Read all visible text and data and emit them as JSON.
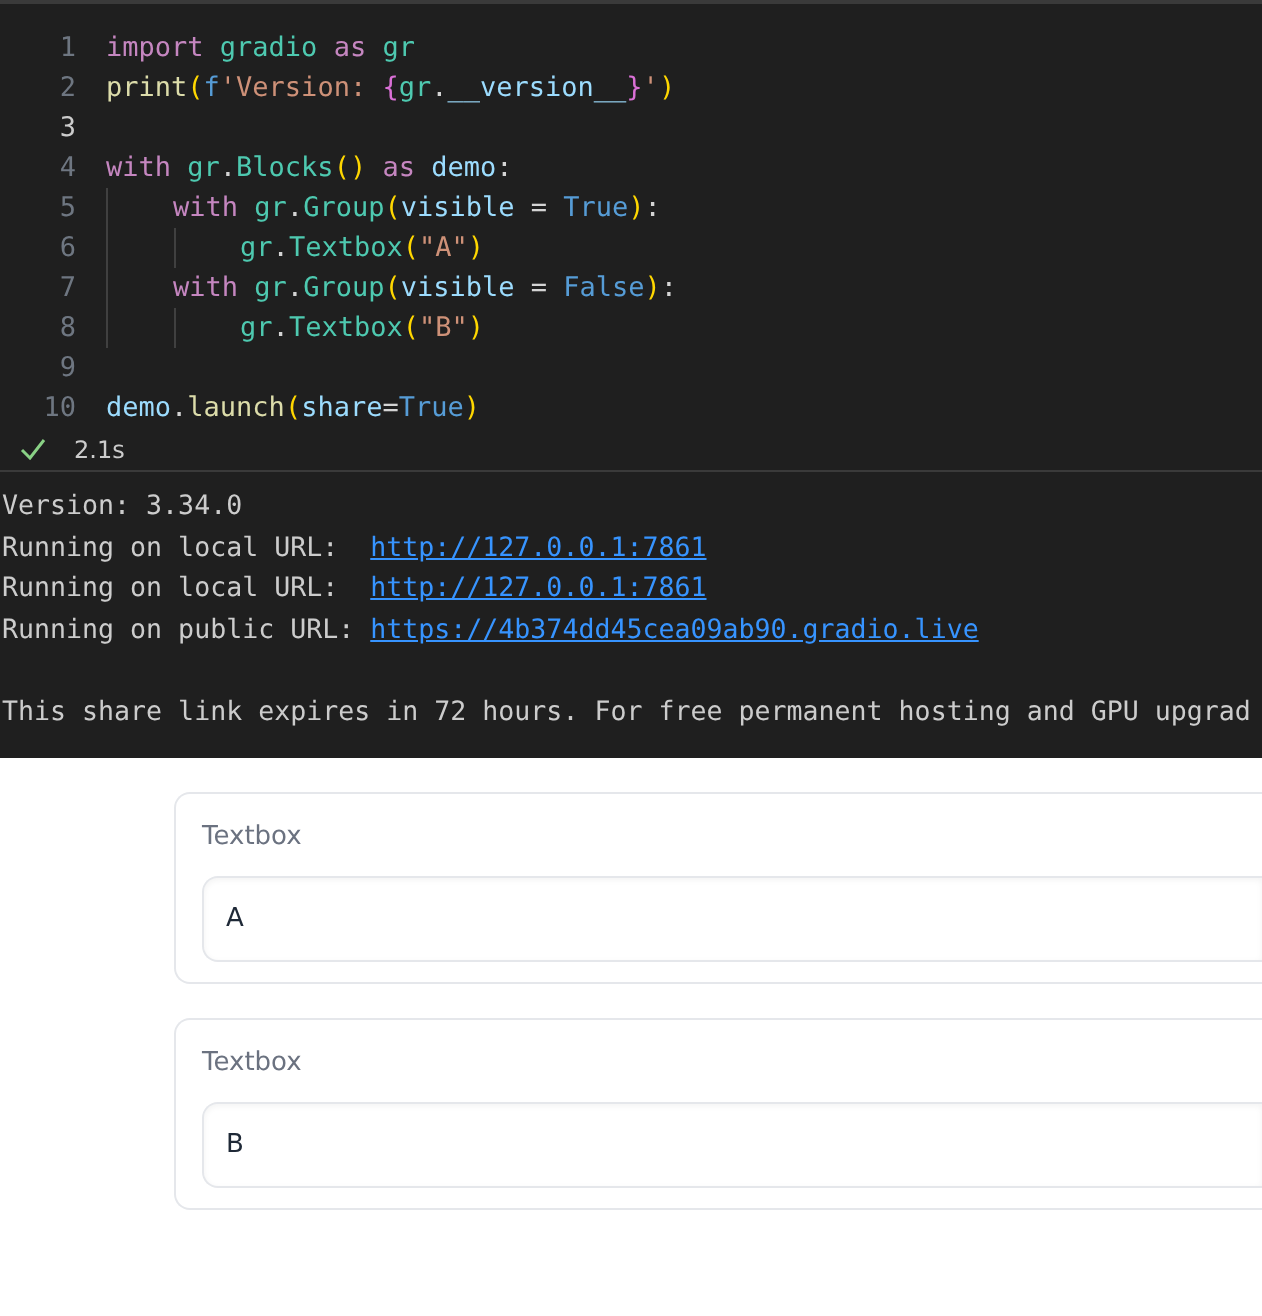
{
  "code_cell": {
    "lines": [
      {
        "number": "1",
        "current": false,
        "tokens": [
          {
            "text": "import ",
            "kind": "keyword"
          },
          {
            "text": "gradio ",
            "kind": "class"
          },
          {
            "text": "as ",
            "kind": "keyword"
          },
          {
            "text": "gr",
            "kind": "class"
          }
        ]
      },
      {
        "number": "2",
        "current": false,
        "tokens": [
          {
            "text": "print",
            "kind": "function"
          },
          {
            "text": "(",
            "kind": "bracket1"
          },
          {
            "text": "f",
            "kind": "constant"
          },
          {
            "text": "'Version: ",
            "kind": "string"
          },
          {
            "text": "{",
            "kind": "bracket2"
          },
          {
            "text": "gr",
            "kind": "class"
          },
          {
            "text": ".",
            "kind": "plain"
          },
          {
            "text": "__version__",
            "kind": "variable"
          },
          {
            "text": "}",
            "kind": "bracket2"
          },
          {
            "text": "'",
            "kind": "string"
          },
          {
            "text": ")",
            "kind": "bracket1"
          }
        ]
      },
      {
        "number": "3",
        "current": true
      },
      {
        "number": "4",
        "current": false,
        "tokens": [
          {
            "text": "with ",
            "kind": "keyword"
          },
          {
            "text": "gr",
            "kind": "class"
          },
          {
            "text": ".",
            "kind": "plain"
          },
          {
            "text": "Blocks",
            "kind": "class"
          },
          {
            "text": "() ",
            "kind": "bracket1"
          },
          {
            "text": "as ",
            "kind": "keyword"
          },
          {
            "text": "demo",
            "kind": "variable"
          },
          {
            "text": ":",
            "kind": "plain"
          }
        ]
      },
      {
        "number": "5",
        "current": false,
        "tokens": [
          {
            "text": "    with ",
            "kind": "keyword"
          },
          {
            "text": "gr",
            "kind": "class"
          },
          {
            "text": ".",
            "kind": "plain"
          },
          {
            "text": "Group",
            "kind": "class"
          },
          {
            "text": "(",
            "kind": "bracket1"
          },
          {
            "text": "visible",
            "kind": "variable"
          },
          {
            "text": " = ",
            "kind": "plain"
          },
          {
            "text": "True",
            "kind": "constant"
          },
          {
            "text": ")",
            "kind": "bracket1"
          },
          {
            "text": ":",
            "kind": "plain"
          }
        ]
      },
      {
        "number": "6",
        "current": false,
        "tokens": [
          {
            "text": "        gr",
            "kind": "class"
          },
          {
            "text": ".",
            "kind": "plain"
          },
          {
            "text": "Textbox",
            "kind": "class"
          },
          {
            "text": "(",
            "kind": "bracket1"
          },
          {
            "text": "\"A\"",
            "kind": "string"
          },
          {
            "text": ")",
            "kind": "bracket1"
          }
        ]
      },
      {
        "number": "7",
        "current": false,
        "tokens": [
          {
            "text": "    with ",
            "kind": "keyword"
          },
          {
            "text": "gr",
            "kind": "class"
          },
          {
            "text": ".",
            "kind": "plain"
          },
          {
            "text": "Group",
            "kind": "class"
          },
          {
            "text": "(",
            "kind": "bracket1"
          },
          {
            "text": "visible",
            "kind": "variable"
          },
          {
            "text": " = ",
            "kind": "plain"
          },
          {
            "text": "False",
            "kind": "constant"
          },
          {
            "text": ")",
            "kind": "bracket1"
          },
          {
            "text": ":",
            "kind": "plain"
          }
        ]
      },
      {
        "number": "8",
        "current": false,
        "tokens": [
          {
            "text": "        gr",
            "kind": "class"
          },
          {
            "text": ".",
            "kind": "plain"
          },
          {
            "text": "Textbox",
            "kind": "class"
          },
          {
            "text": "(",
            "kind": "bracket1"
          },
          {
            "text": "\"B\"",
            "kind": "string"
          },
          {
            "text": ")",
            "kind": "bracket1"
          }
        ]
      },
      {
        "number": "9",
        "current": false
      },
      {
        "number": "10",
        "current": false,
        "tokens": [
          {
            "text": "demo",
            "kind": "variable"
          },
          {
            "text": ".",
            "kind": "plain"
          },
          {
            "text": "launch",
            "kind": "function"
          },
          {
            "text": "(",
            "kind": "bracket1"
          },
          {
            "text": "share",
            "kind": "variable"
          },
          {
            "text": "=",
            "kind": "plain"
          },
          {
            "text": "True",
            "kind": "constant"
          },
          {
            "text": ")",
            "kind": "bracket1"
          }
        ]
      }
    ],
    "status": {
      "time": "2.1s"
    }
  },
  "output": {
    "paragraphs": [
      {
        "lines": [
          {
            "segments": [
              {
                "text": "Version: 3.34.0",
                "kind": "text"
              }
            ]
          },
          {
            "segments": [
              {
                "text": "Running on local URL:  ",
                "kind": "text"
              },
              {
                "text": "http://127.0.0.1:7861",
                "kind": "link"
              }
            ]
          },
          {
            "segments": [
              {
                "text": "Running on local URL:  ",
                "kind": "text"
              },
              {
                "text": "http://127.0.0.1:7861",
                "kind": "link"
              }
            ]
          },
          {
            "segments": [
              {
                "text": "Running on public URL: ",
                "kind": "text"
              },
              {
                "text": "https://4b374dd45cea09ab90.gradio.live",
                "kind": "link"
              }
            ]
          }
        ]
      },
      {
        "lines": [
          {
            "segments": [
              {
                "text": "This share link expires in 72 hours. For free permanent hosting and GPU upgrad",
                "kind": "text"
              }
            ]
          }
        ]
      }
    ]
  },
  "app": {
    "textboxes": [
      {
        "label": "Textbox",
        "value": "A"
      },
      {
        "label": "Textbox",
        "value": "B"
      }
    ]
  }
}
